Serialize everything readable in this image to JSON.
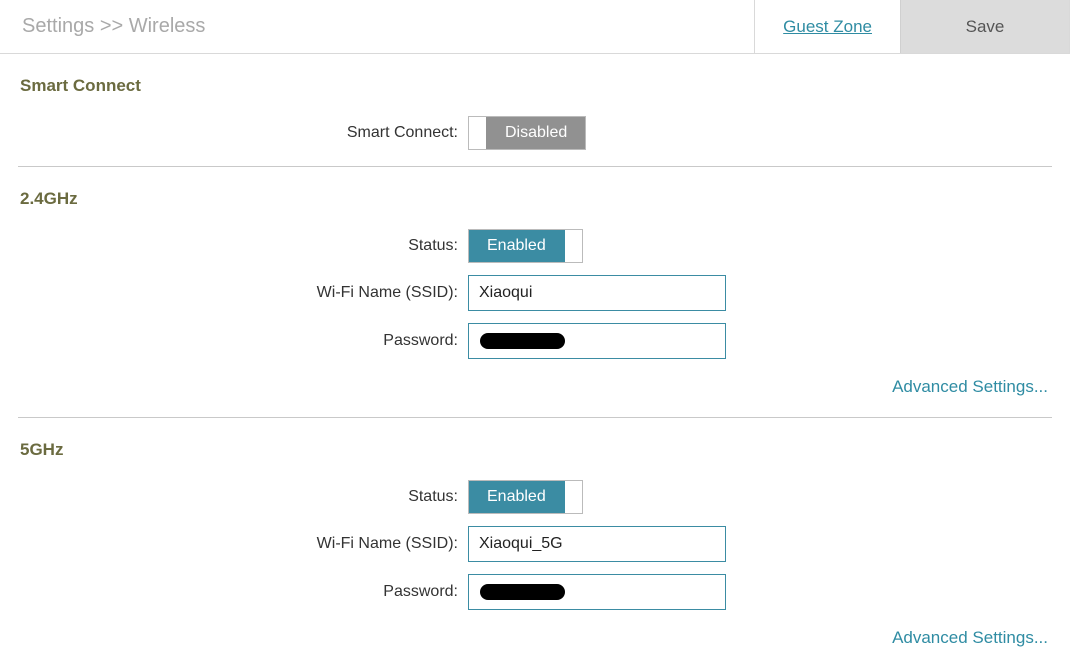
{
  "breadcrumb": "Settings >> Wireless",
  "topbar": {
    "guest_zone": "Guest Zone",
    "save": "Save"
  },
  "sections": {
    "smart_connect": {
      "title": "Smart Connect",
      "label": "Smart Connect:",
      "toggle_text": "Disabled"
    },
    "band24": {
      "title": "2.4GHz",
      "status_label": "Status:",
      "status_toggle_text": "Enabled",
      "ssid_label": "Wi-Fi Name (SSID):",
      "ssid_value": "Xiaoqui",
      "password_label": "Password:",
      "advanced": "Advanced Settings..."
    },
    "band5": {
      "title": "5GHz",
      "status_label": "Status:",
      "status_toggle_text": "Enabled",
      "ssid_label": "Wi-Fi Name (SSID):",
      "ssid_value": "Xiaoqui_5G",
      "password_label": "Password:",
      "advanced": "Advanced Settings..."
    }
  }
}
